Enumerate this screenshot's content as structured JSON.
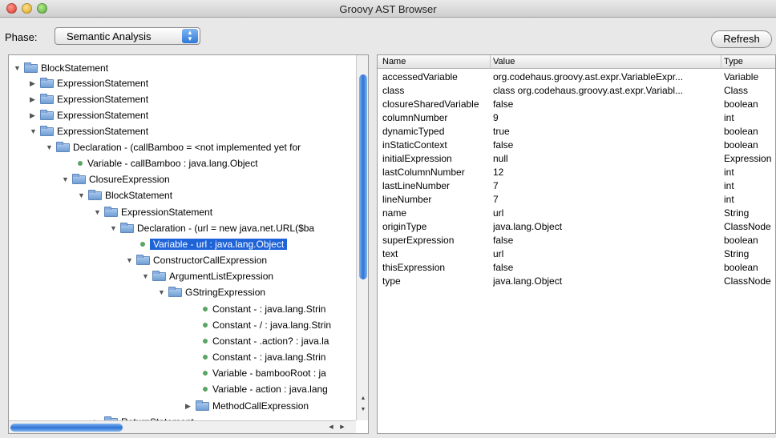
{
  "window": {
    "title": "Groovy AST Browser"
  },
  "toolbar": {
    "phase_label": "Phase:",
    "phase_value": "Semantic Analysis",
    "refresh_label": "Refresh"
  },
  "tree": {
    "rows": [
      {
        "label": "BlockStatement"
      },
      {
        "label": "ExpressionStatement"
      },
      {
        "label": "ExpressionStatement"
      },
      {
        "label": "ExpressionStatement"
      },
      {
        "label": "ExpressionStatement"
      },
      {
        "label": "Declaration - (callBamboo = <not implemented yet for"
      },
      {
        "label": "Variable - callBamboo : java.lang.Object"
      },
      {
        "label": "ClosureExpression"
      },
      {
        "label": "BlockStatement"
      },
      {
        "label": "ExpressionStatement"
      },
      {
        "label": "Declaration - (url = new java.net.URL($ba"
      },
      {
        "label": "Variable - url : java.lang.Object"
      },
      {
        "label": "ConstructorCallExpression"
      },
      {
        "label": "ArgumentListExpression"
      },
      {
        "label": "GStringExpression"
      },
      {
        "label": "Constant - : java.lang.Strin"
      },
      {
        "label": "Constant - / : java.lang.Strin"
      },
      {
        "label": "Constant - .action? : java.la"
      },
      {
        "label": "Constant - : java.lang.Strin"
      },
      {
        "label": "Variable - bambooRoot : ja"
      },
      {
        "label": "Variable - action : java.lang"
      },
      {
        "label": "MethodCallExpression"
      },
      {
        "label": "ReturnStatement"
      }
    ]
  },
  "table": {
    "headers": [
      "Name",
      "Value",
      "Type"
    ],
    "rows": [
      [
        "accessedVariable",
        "org.codehaus.groovy.ast.expr.VariableExpr...",
        "Variable"
      ],
      [
        "class",
        "class org.codehaus.groovy.ast.expr.Variabl...",
        "Class"
      ],
      [
        "closureSharedVariable",
        "false",
        "boolean"
      ],
      [
        "columnNumber",
        "9",
        "int"
      ],
      [
        "dynamicTyped",
        "true",
        "boolean"
      ],
      [
        "inStaticContext",
        "false",
        "boolean"
      ],
      [
        "initialExpression",
        "null",
        "Expression"
      ],
      [
        "lastColumnNumber",
        "12",
        "int"
      ],
      [
        "lastLineNumber",
        "7",
        "int"
      ],
      [
        "lineNumber",
        "7",
        "int"
      ],
      [
        "name",
        "url",
        "String"
      ],
      [
        "originType",
        "java.lang.Object",
        "ClassNode"
      ],
      [
        "superExpression",
        "false",
        "boolean"
      ],
      [
        "text",
        "url",
        "String"
      ],
      [
        "thisExpression",
        "false",
        "boolean"
      ],
      [
        "type",
        "java.lang.Object",
        "ClassNode"
      ]
    ]
  },
  "colors": {
    "selection": "#1f63d8",
    "leaf_bullet": "#5aa564",
    "folder": "#6f9fd6"
  }
}
